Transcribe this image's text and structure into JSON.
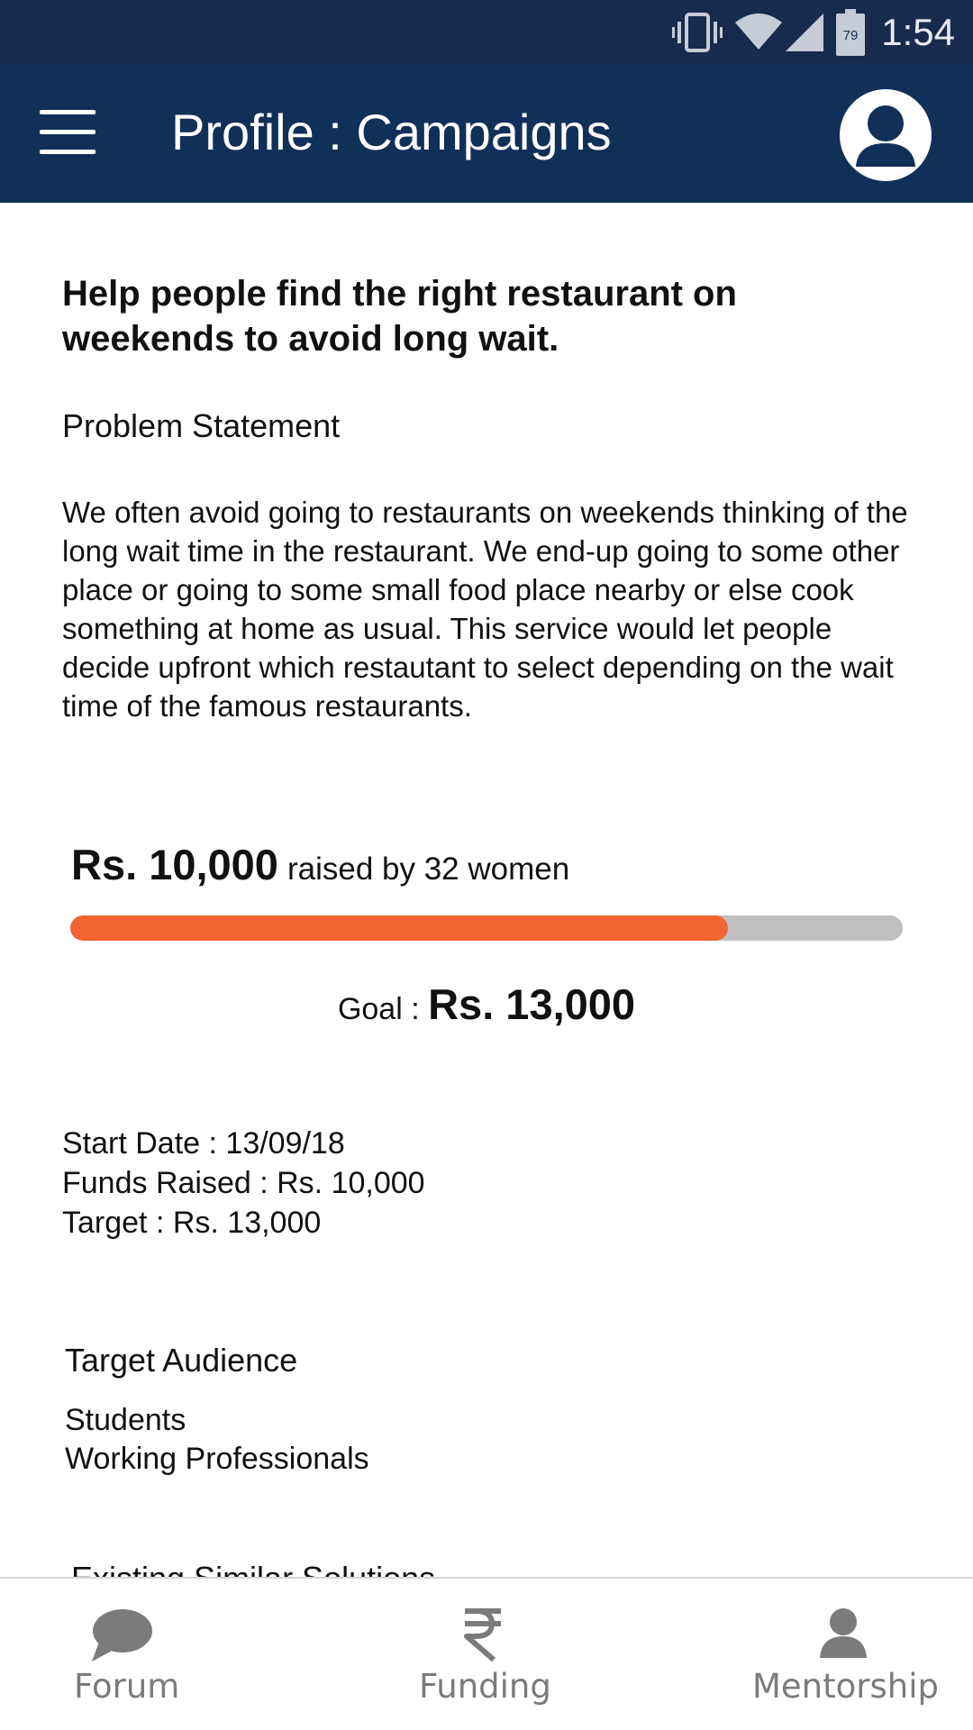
{
  "status_bar": {
    "battery_level": "79",
    "time": "1:54",
    "icons": [
      "vibrate-icon",
      "wifi-icon",
      "signal-icon",
      "battery-icon"
    ]
  },
  "app_bar": {
    "title": "Profile : Campaigns",
    "menu_icon": "hamburger-menu-icon",
    "profile_icon": "user-avatar-icon"
  },
  "campaign": {
    "headline": "Help people find the right restaurant on weekends to avoid long wait.",
    "problem_label": "Problem Statement",
    "problem_text": "We often avoid going to restaurants on weekends thinking of the long wait time in the restaurant. We end-up going to some other place or going to some small food place nearby or else cook something at home as usual. This service would let people decide upfront which restautant to select depending on the wait time of the famous restaurants.",
    "raised_amount": "Rs. 10,000",
    "raised_text": "raised by 32 women",
    "progress_fraction": 0.79,
    "goal_label": "Goal : ",
    "goal_amount": "Rs. 13,000",
    "start_date": "Start Date : 13/09/18",
    "funds_raised": "Funds Raised : Rs. 10,000",
    "target": "Target : Rs. 13,000",
    "audience_title": "Target Audience",
    "audience": [
      "Students",
      "Working Professionals"
    ],
    "similar_title": "Existing Similar Solutions"
  },
  "bottom_nav": {
    "items": [
      {
        "label": "Forum",
        "icon": "chat-bubble-icon"
      },
      {
        "label": "Funding",
        "icon": "rupee-icon"
      },
      {
        "label": "Mentorship",
        "icon": "person-icon"
      }
    ]
  },
  "colors": {
    "status_bar": "#172b4d",
    "app_bar": "#113058",
    "progress_fill": "#f26430",
    "progress_track": "#c0c0c0",
    "nav_inactive": "#7b7b7b"
  }
}
